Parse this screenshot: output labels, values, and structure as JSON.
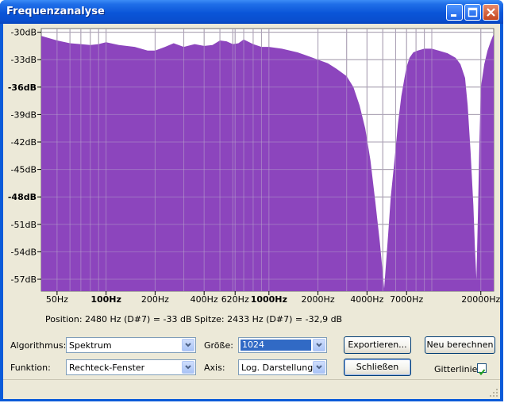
{
  "window": {
    "title": "Frequenzanalyse"
  },
  "chart_data": {
    "type": "area",
    "title": "",
    "xlabel": "",
    "ylabel": "",
    "xscale": "log",
    "xlim": [
      40,
      24000
    ],
    "ylim": [
      -58.3,
      -29.6
    ],
    "grid": true,
    "y_ticks": [
      {
        "value": -30,
        "label": "-30dB",
        "bold": false
      },
      {
        "value": -33,
        "label": "-33dB",
        "bold": false
      },
      {
        "value": -36,
        "label": "-36dB",
        "bold": true
      },
      {
        "value": -39,
        "label": "-39dB",
        "bold": false
      },
      {
        "value": -42,
        "label": "-42dB",
        "bold": false
      },
      {
        "value": -45,
        "label": "-45dB",
        "bold": false
      },
      {
        "value": -48,
        "label": "-48dB",
        "bold": true
      },
      {
        "value": -51,
        "label": "-51dB",
        "bold": false
      },
      {
        "value": -54,
        "label": "-54dB",
        "bold": false
      },
      {
        "value": -57,
        "label": "-57dB",
        "bold": false
      }
    ],
    "x_ticks": [
      {
        "value": 50,
        "label": "50Hz",
        "bold": false
      },
      {
        "value": 100,
        "label": "100Hz",
        "bold": true
      },
      {
        "value": 200,
        "label": "200Hz",
        "bold": false
      },
      {
        "value": 400,
        "label": "400Hz",
        "bold": false
      },
      {
        "value": 620,
        "label": "620Hz",
        "bold": false
      },
      {
        "value": 1000,
        "label": "1000Hz",
        "bold": true
      },
      {
        "value": 2000,
        "label": "2000Hz",
        "bold": false
      },
      {
        "value": 4000,
        "label": "4000Hz",
        "bold": false
      },
      {
        "value": 7000,
        "label": "7000Hz",
        "bold": false
      },
      {
        "value": 20000,
        "label": "20000Hz",
        "bold": false
      }
    ],
    "minor_gridlines_hz": [
      60,
      70,
      80,
      90,
      300,
      500,
      600,
      700,
      800,
      900,
      3000,
      5000,
      6000,
      8000,
      9000,
      10000
    ],
    "series": [
      {
        "color": "#8c45bd",
        "x": [
          40,
          50,
          60,
          70,
          80,
          90,
          100,
          120,
          150,
          180,
          200,
          230,
          260,
          300,
          350,
          400,
          450,
          500,
          550,
          600,
          650,
          700,
          800,
          900,
          1000,
          1200,
          1500,
          1800,
          2000,
          2300,
          2600,
          3000,
          3300,
          3600,
          3900,
          4200,
          4500,
          4800,
          5100,
          5400,
          5600,
          5900,
          6200,
          6500,
          6800,
          7000,
          7300,
          7700,
          8200,
          9000,
          10000,
          11000,
          12500,
          14000,
          15000,
          16000,
          16600,
          17300,
          18000,
          18400,
          18800,
          19200,
          19600,
          20000,
          21000,
          22000,
          23000,
          24000
        ],
        "values": [
          -30.4,
          -30.9,
          -31.2,
          -31.3,
          -31.4,
          -31.3,
          -31.1,
          -31.4,
          -31.6,
          -32.0,
          -32.0,
          -31.6,
          -31.2,
          -31.6,
          -31.3,
          -31.5,
          -31.4,
          -30.9,
          -31.0,
          -31.3,
          -31.2,
          -30.8,
          -31.3,
          -31.6,
          -31.6,
          -31.8,
          -32.2,
          -32.7,
          -33.0,
          -33.4,
          -34.0,
          -34.8,
          -36.0,
          -38.0,
          -40.5,
          -44.0,
          -48.5,
          -53.0,
          -58.0,
          -52.0,
          -48.0,
          -44.0,
          -40.0,
          -37.0,
          -35.0,
          -33.8,
          -32.8,
          -32.2,
          -32.0,
          -31.8,
          -31.8,
          -32.0,
          -32.3,
          -32.8,
          -33.5,
          -35.0,
          -38.0,
          -43.0,
          -49.0,
          -53.5,
          -57.0,
          -50.0,
          -42.0,
          -36.0,
          -33.5,
          -32.0,
          -31.0,
          -30.2
        ]
      }
    ]
  },
  "status": {
    "text": "Position: 2480 Hz (D#7) = -33 dB   Spitze: 2433 Hz (D#7) = -32,9 dB"
  },
  "controls": {
    "algorithm_label": "Algorithmus:",
    "algorithm_value": "Spektrum",
    "function_label": "Funktion:",
    "function_value": "Rechteck-Fenster",
    "size_label": "Größe:",
    "size_value": "1024",
    "axis_label": "Axis:",
    "axis_value": "Log. Darstellung",
    "export_button": "Exportieren...",
    "recalc_button": "Neu berechnen",
    "close_button": "Schließen",
    "gridlines_label": "Gitterlinien",
    "gridlines_checked": true
  },
  "colors": {
    "plot_fill": "#8c45bd",
    "grid": "#9a9a9a",
    "background": "#ece9d8",
    "titlebar": "#0a55d8"
  }
}
